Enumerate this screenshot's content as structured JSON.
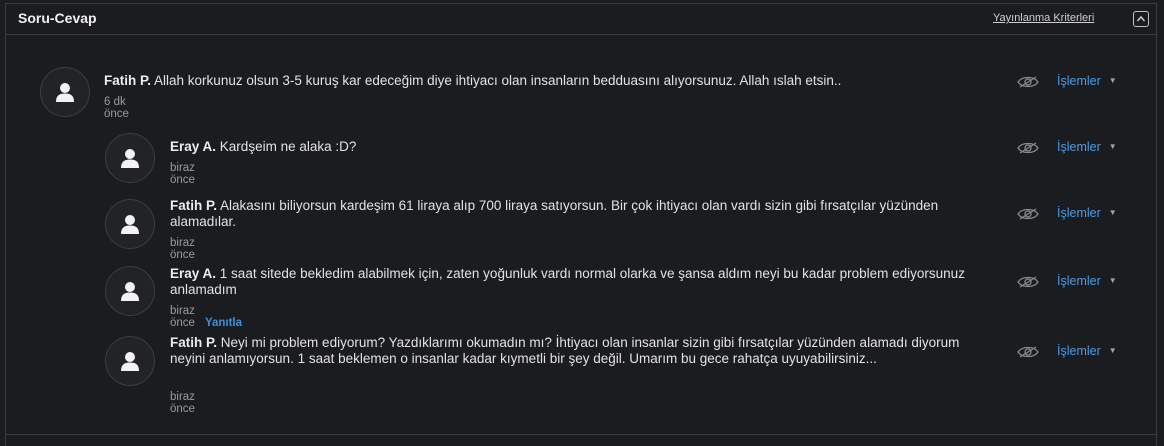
{
  "panel": {
    "title": "Soru-Cevap",
    "criteria_link": "Yayınlanma Kriterleri"
  },
  "comments": [
    {
      "author": "Fatih P.",
      "text": "Allah korkunuz olsun 3-5 kuruş kar edeceğim diye ihtiyacı olan insanların bedduasını alıyorsunuz. Allah ıslah etsin..",
      "time": "6 dk önce",
      "actions_label": "İşlemler",
      "reply": false
    },
    {
      "author": "Eray A.",
      "text": "Kardşeim ne alaka :D?",
      "time": "biraz önce",
      "actions_label": "İşlemler",
      "reply": true
    },
    {
      "author": "Fatih P.",
      "text": "Alakasını biliyorsun kardeşim 61 liraya alıp 700 liraya satıyorsun. Bir çok ihtiyacı olan vardı sizin gibi fırsatçılar yüzünden alamadılar.",
      "time": "biraz önce",
      "actions_label": "İşlemler",
      "reply": true
    },
    {
      "author": "Eray A.",
      "text": "1 saat sitede bekledim alabilmek için, zaten yoğunluk vardı normal olarka ve şansa aldım neyi bu kadar problem ediyorsunuz anlamadım",
      "time": "biraz önce",
      "reply_label": "Yanıtla",
      "actions_label": "İşlemler",
      "reply": true
    },
    {
      "author": "Fatih P.",
      "text": "Neyi mi problem ediyorum? Yazdıklarımı okumadın mı? İhtiyacı olan insanlar sizin gibi fırsatçılar yüzünden alamadı diyorum neyini anlamıyorsun. 1 saat beklemen o insanlar kadar kıymetli bir şey değil. Umarım bu gece rahatça uyuyabilirsiniz...",
      "time": "biraz önce",
      "actions_label": "İşlemler",
      "reply": true
    }
  ],
  "icons": {
    "avatar": "user-silhouette-icon",
    "visibility": "eye-icon",
    "collapse": "chevron-up-icon",
    "actions_caret": "caret-down-icon"
  }
}
